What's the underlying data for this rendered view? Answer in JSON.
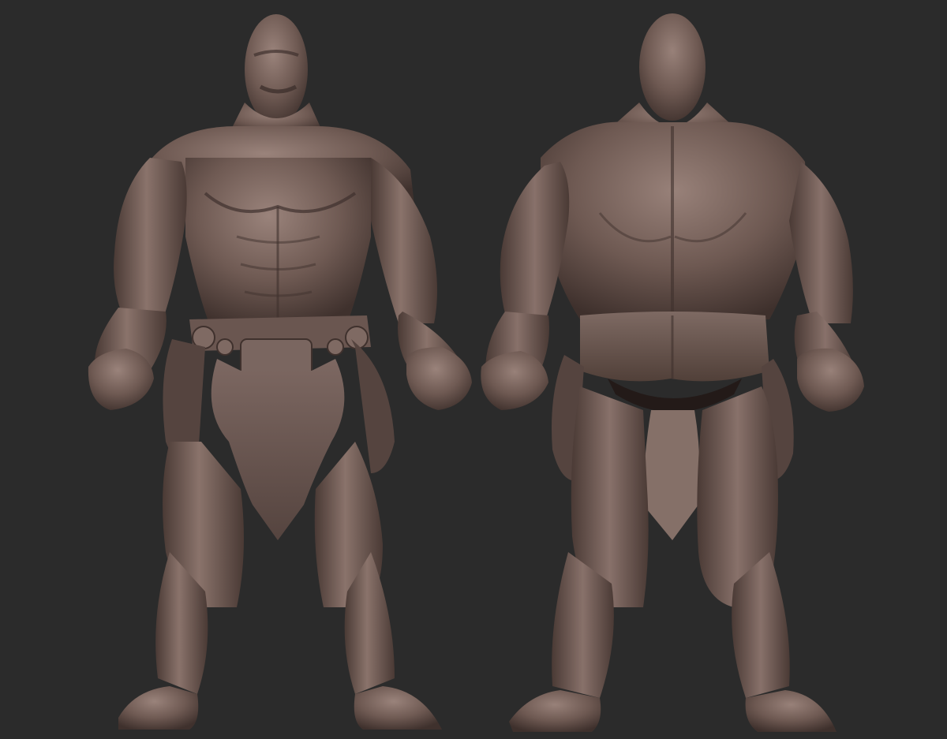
{
  "scene": {
    "views": [
      {
        "id": "front",
        "name": "front-view"
      },
      {
        "id": "back",
        "name": "back-view"
      }
    ],
    "colors": {
      "background": "#2b2b2b",
      "clay_light": "#8c766f",
      "clay_mid": "#6b5650",
      "clay_dark": "#3e302c",
      "clay_shadow": "#231a18"
    }
  }
}
